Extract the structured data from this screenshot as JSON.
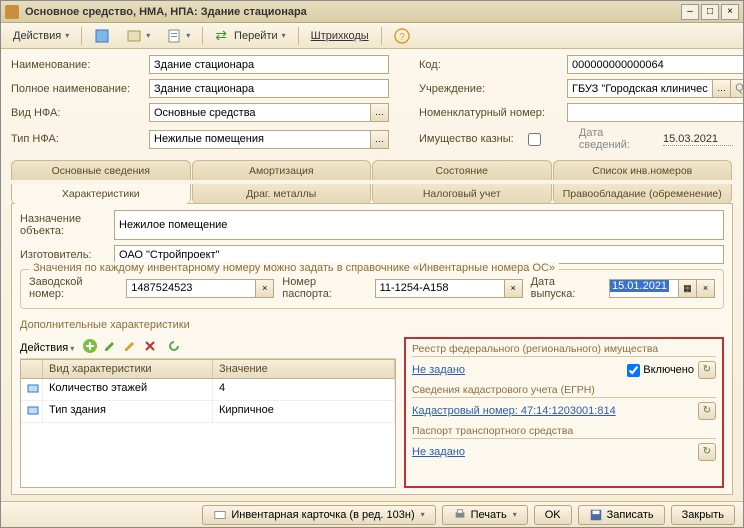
{
  "window": {
    "title": "Основное средство, НМА, НПА: Здание стационара"
  },
  "toolbar": {
    "actions": "Действия",
    "goto": "Перейти",
    "barcodes": "Штрихкоды"
  },
  "fields": {
    "name_lbl": "Наименование:",
    "name": "Здание стационара",
    "fullname_lbl": "Полное наименование:",
    "fullname": "Здание стационара",
    "vidnfa_lbl": "Вид НФА:",
    "vidnfa": "Основные средства",
    "tipnfa_lbl": "Тип НФА:",
    "tipnfa": "Нежилые помещения",
    "code_lbl": "Код:",
    "code": "000000000000064",
    "inst_lbl": "Учреждение:",
    "inst": "ГБУЗ \"Городская клиническая бол...",
    "nomen_lbl": "Номенклатурный номер:",
    "nomen": "",
    "treasury_lbl": "Имущество казны:",
    "infodate_lbl": "Дата сведений:",
    "infodate": "15.03.2021"
  },
  "tabs_top": [
    "Основные сведения",
    "Амортизация",
    "Состояние",
    "Список инв.номеров"
  ],
  "tabs_bot": [
    "Характеристики",
    "Драг. металлы",
    "Налоговый учет",
    "Правообладание (обременение)"
  ],
  "char": {
    "purpose_lbl": "Назначение объекта:",
    "purpose": "Нежилое помещение",
    "maker_lbl": "Изготовитель:",
    "maker": "ОАО \"Стройпроект\"",
    "fs_title": "Значения по каждому инвентарному номеру можно задать в справочнике «Инвентарные номера ОС»",
    "factory_lbl": "Заводской номер:",
    "factory": "1487524523",
    "passport_lbl": "Номер паспорта:",
    "passport": "11-1254-А158",
    "release_lbl": "Дата выпуска:",
    "release": "15.01.2021"
  },
  "dop": {
    "title": "Дополнительные характеристики",
    "actions": "Действия",
    "cols": [
      "",
      "Вид характеристики",
      "Значение"
    ],
    "rows": [
      {
        "name": "Количество этажей",
        "val": "4"
      },
      {
        "name": "Тип здания",
        "val": "Кирпичное"
      }
    ]
  },
  "right": {
    "reestr_title": "Реестр федерального (регионального) имущества",
    "notset": "Не задано",
    "included": "Включено",
    "kad_title": "Сведения кадастрового учета (ЕГРН)",
    "kad_link": "Кадастровый номер: 47:14:1203001:814",
    "pts_title": "Паспорт транспортного средства"
  },
  "footer": {
    "inv_card": "Инвентарная карточка (в ред. 103н)",
    "print": "Печать",
    "ok": "OK",
    "save": "Записать",
    "close": "Закрыть"
  }
}
